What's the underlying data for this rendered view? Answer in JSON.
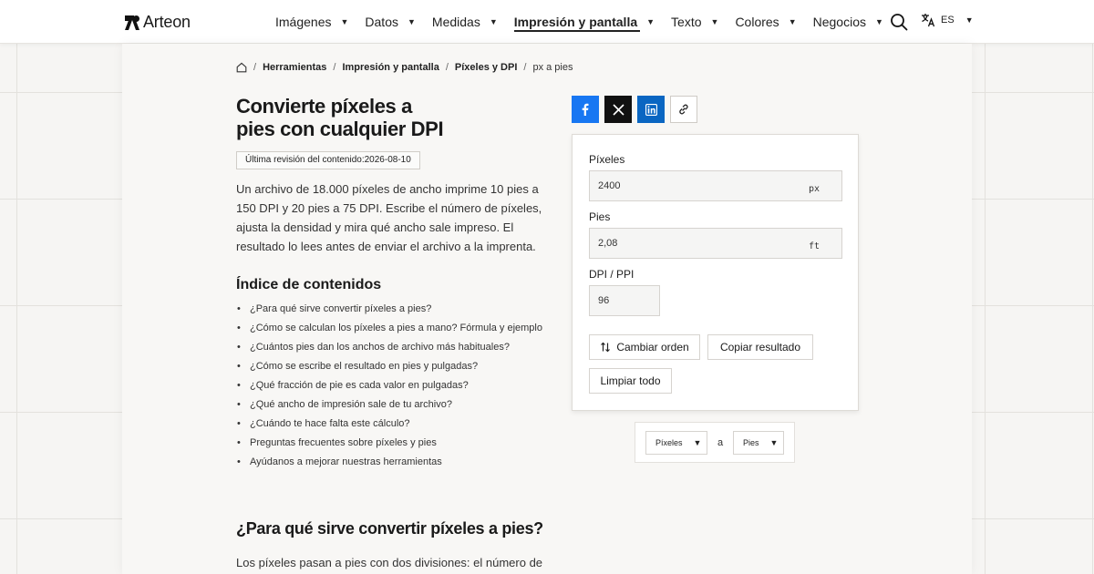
{
  "header": {
    "logo_text": "Arteon",
    "nav": [
      {
        "label": "Imágenes",
        "active": false
      },
      {
        "label": "Datos",
        "active": false
      },
      {
        "label": "Medidas",
        "active": false
      },
      {
        "label": "Impresión y pantalla",
        "active": true
      },
      {
        "label": "Texto",
        "active": false
      },
      {
        "label": "Colores",
        "active": false
      },
      {
        "label": "Negocios",
        "active": false
      }
    ],
    "search_icon": "search-icon",
    "language_icon": "translate-icon",
    "language_code": "ES"
  },
  "breadcrumb": {
    "home_icon": "home-icon",
    "items": [
      "Herramientas",
      "Impresión y pantalla",
      "Píxeles y DPI"
    ],
    "current": "px a pies",
    "separator": "/"
  },
  "page": {
    "title_line1": "Convierte píxeles a",
    "title_line2": "pies con cualquier DPI",
    "revision_label": "Última revisión del contenido:",
    "revision_date": "2026-08-10",
    "intro": "Un archivo de 18.000 píxeles de ancho imprime 10 pies a 150 DPI y 20 pies a 75 DPI. Escribe el número de píxeles, ajusta la densidad y mira qué ancho sale impreso. El resultado lo lees antes de enviar el archivo a la imprenta.",
    "toc_title": "Índice de contenidos",
    "toc": [
      "¿Para qué sirve convertir píxeles a pies?",
      "¿Cómo se calculan los píxeles a pies a mano? Fórmula y ejemplo",
      "¿Cuántos pies dan los anchos de archivo más habituales?",
      "¿Cómo se escribe el resultado en pies y pulgadas?",
      "¿Qué fracción de pie es cada valor en pulgadas?",
      "¿Qué ancho de impresión sale de tu archivo?",
      "¿Cuándo te hace falta este cálculo?",
      "Preguntas frecuentes sobre píxeles y pies",
      "Ayúdanos a mejorar nuestras herramientas"
    ],
    "section_heading": "¿Para qué sirve convertir píxeles a pies?",
    "section_text": "Los píxeles pasan a pies con dos divisiones: el número de"
  },
  "share": {
    "facebook_icon": "facebook-icon",
    "x_icon": "x-icon",
    "linkedin_icon": "linkedin-icon",
    "link_icon": "link-icon"
  },
  "converter": {
    "pixels_label": "Píxeles",
    "pixels_value": "2400",
    "pixels_unit": "px",
    "feet_label": "Pies",
    "feet_value": "2,08",
    "feet_unit": "ft",
    "dpi_label": "DPI / PPI",
    "dpi_value": "96",
    "swap_label": "Cambiar orden",
    "swap_icon": "swap-vertical-icon",
    "copy_label": "Copiar resultado",
    "clear_label": "Limpiar todo"
  },
  "units": {
    "from": "Píxeles",
    "connector": "a",
    "to": "Pies"
  },
  "colors": {
    "facebook": "#1877f2",
    "x": "#111111",
    "linkedin": "#0a66c2"
  }
}
